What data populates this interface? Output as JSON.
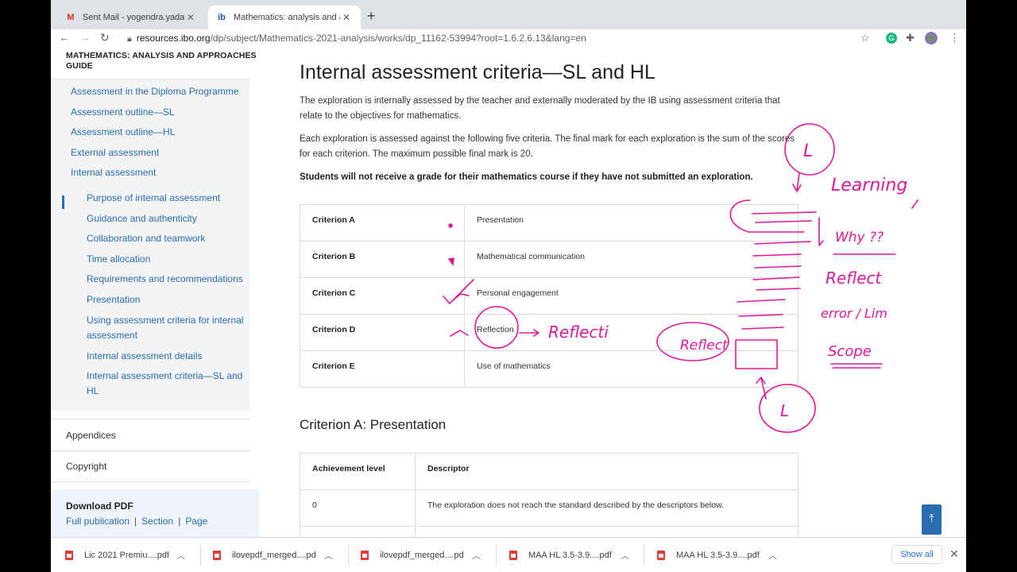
{
  "browser": {
    "tabs": [
      {
        "title": "Sent Mail - yogendra.yadav@o",
        "favicon": "gmail-icon"
      },
      {
        "title": "Mathematics: analysis and app",
        "favicon": "ib-icon"
      }
    ],
    "url_host": "resources.ibo.org",
    "url_path": "/dp/subject/Mathematics-2021-analysis/works/dp_11162-53994?root=1.6.2.6.13&lang=en"
  },
  "sidebar": {
    "guide_title": "MATHEMATICS: ANALYSIS AND APPROACHES GUIDE",
    "top_links": [
      "Assessment in the Diploma Programme",
      "Assessment outline—SL",
      "Assessment outline—HL",
      "External assessment",
      "Internal assessment"
    ],
    "sub_links": [
      "Purpose of internal assessment",
      "Guidance and authenticity",
      "Collaboration and teamwork",
      "Time allocation",
      "Requirements and recommendations",
      "Presentation",
      "Using assessment criteria for internal assessment",
      "Internal assessment details",
      "Internal assessment criteria—SL and HL"
    ],
    "appendices": "Appendices",
    "copyright": "Copyright",
    "download_title": "Download PDF",
    "download_links": [
      "Full publication",
      "Section",
      "Page"
    ],
    "separator": "|"
  },
  "main": {
    "title": "Internal assessment criteria—SL and HL",
    "para1": "The exploration is internally assessed by the teacher and externally moderated by the IB using assessment criteria that relate to the objectives for mathematics.",
    "para2": "Each exploration is assessed against the following five criteria. The final mark for each exploration is the sum of the scores for each criterion. The maximum possible final mark is 20.",
    "para3": "Students will not receive a grade for their mathematics course if they have not submitted an exploration.",
    "criteria": [
      {
        "name": "Criterion A",
        "desc": "Presentation"
      },
      {
        "name": "Criterion B",
        "desc": "Mathematical communication"
      },
      {
        "name": "Criterion C",
        "desc": "Personal engagement"
      },
      {
        "name": "Criterion D",
        "desc": "Reflection"
      },
      {
        "name": "Criterion E",
        "desc": "Use of mathematics"
      }
    ],
    "section_title": "Criterion A: Presentation",
    "achievement_header": {
      "level": "Achievement level",
      "descriptor": "Descriptor"
    },
    "achievement_rows": [
      {
        "level": "0",
        "descriptor": "The exploration does not reach the standard described by the descriptors below."
      }
    ]
  },
  "downloads": {
    "items": [
      "Lic 2021 Premiu....pdf",
      "ilovepdf_merged....pdf",
      "ilovepdf_merged....pdf",
      "MAA HL 3.5-3.9....pdf",
      "MAA HL 3.5-3.9....pdf"
    ],
    "show_all": "Show all"
  },
  "annotations": {
    "ink_color": "#e0179b",
    "handwritten": [
      "L",
      "Learning",
      "Why ??",
      "Reflect",
      "error / Lim",
      "Scope",
      "Reflect",
      "L",
      "Reflecti"
    ]
  }
}
